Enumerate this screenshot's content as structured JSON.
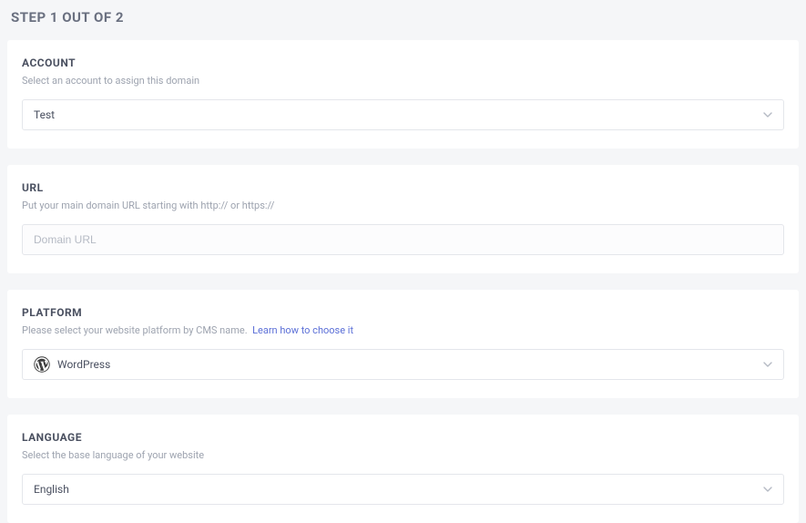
{
  "step": {
    "title": "STEP 1 OUT OF 2"
  },
  "account": {
    "label": "ACCOUNT",
    "hint": "Select an account to assign this domain",
    "value": "Test"
  },
  "url": {
    "label": "URL",
    "hint": "Put your main domain URL starting with http:// or https://",
    "placeholder": "Domain URL"
  },
  "platform": {
    "label": "PLATFORM",
    "hint_prefix": "Please select your website platform by CMS name.",
    "hint_link": "Learn how to choose it",
    "value": "WordPress"
  },
  "language": {
    "label": "LANGUAGE",
    "hint": "Select the base language of your website",
    "value": "English"
  }
}
